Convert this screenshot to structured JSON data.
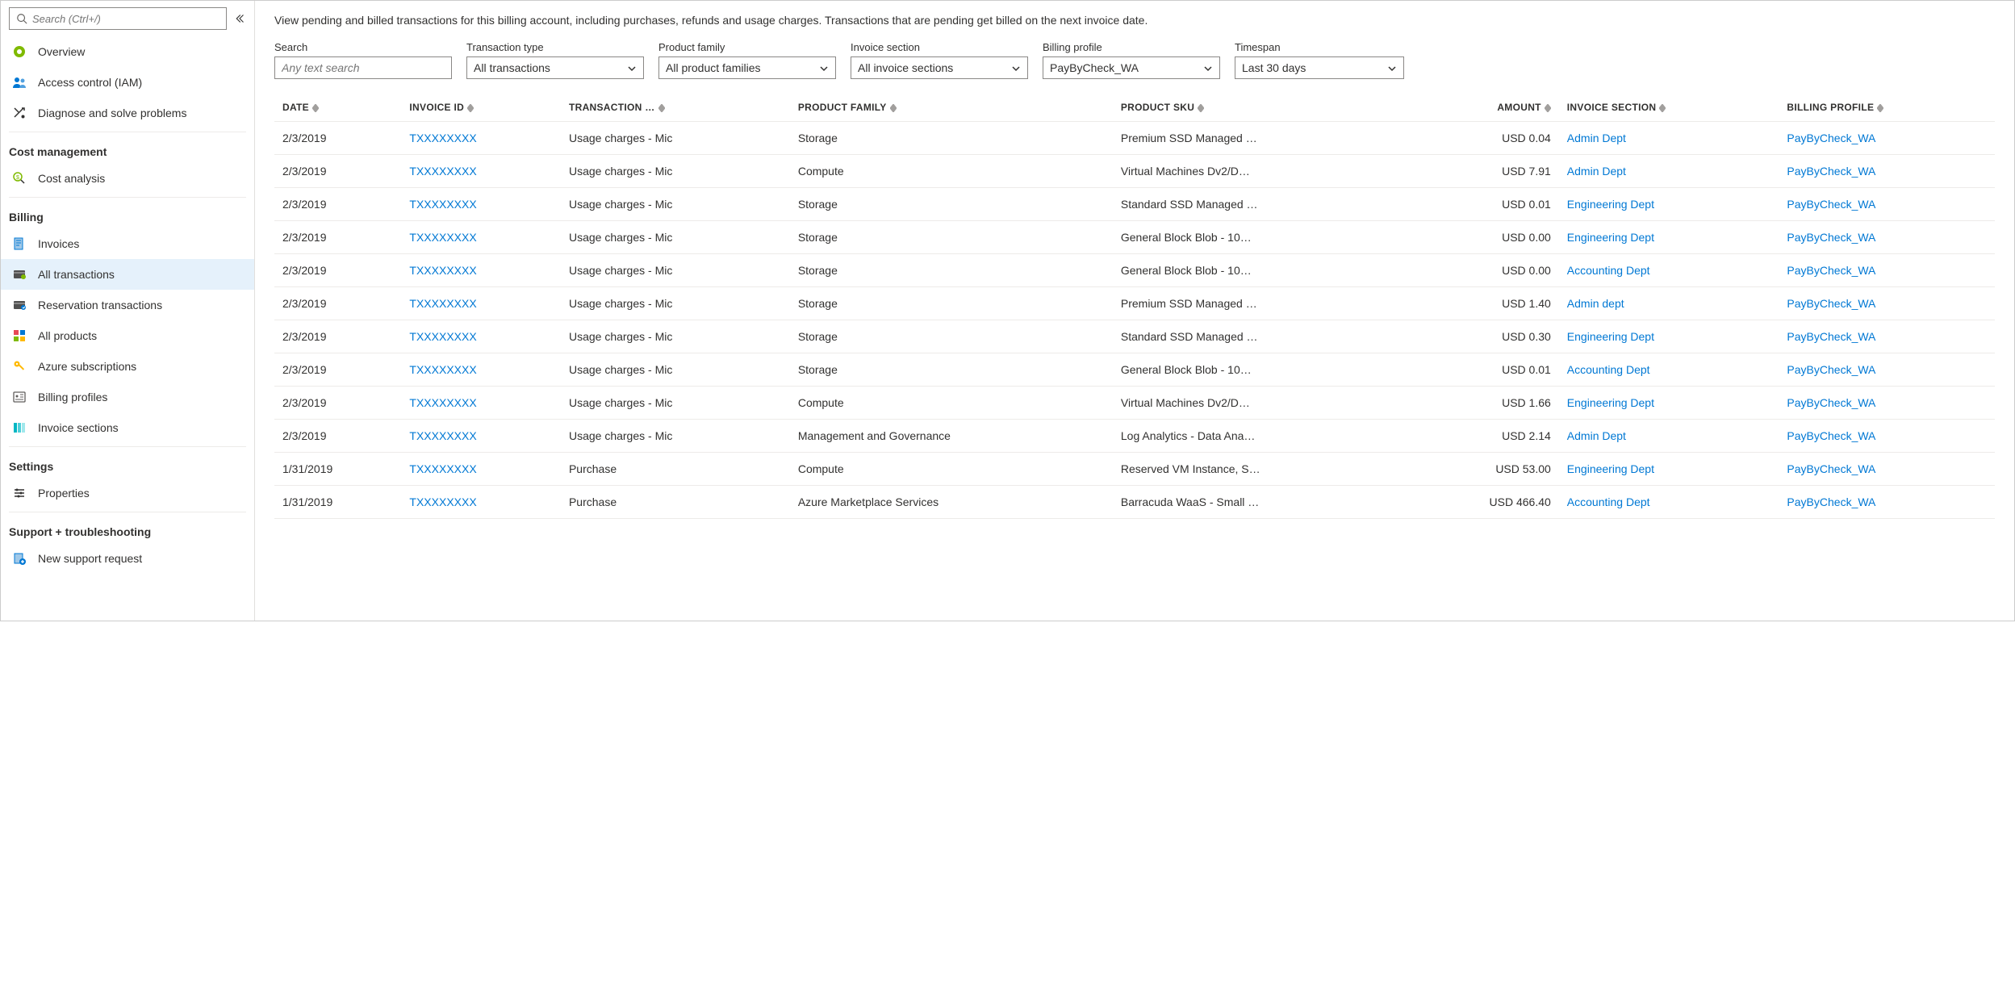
{
  "sidebar": {
    "search_placeholder": "Search (Ctrl+/)",
    "top": [
      {
        "label": "Overview",
        "icon": "overview"
      },
      {
        "label": "Access control (IAM)",
        "icon": "iam"
      },
      {
        "label": "Diagnose and solve problems",
        "icon": "diagnose"
      }
    ],
    "sections": [
      {
        "title": "Cost management",
        "items": [
          {
            "label": "Cost analysis",
            "icon": "cost-analysis"
          }
        ]
      },
      {
        "title": "Billing",
        "items": [
          {
            "label": "Invoices",
            "icon": "invoices"
          },
          {
            "label": "All transactions",
            "icon": "all-transactions",
            "active": true
          },
          {
            "label": "Reservation transactions",
            "icon": "reservation"
          },
          {
            "label": "All products",
            "icon": "products"
          },
          {
            "label": "Azure subscriptions",
            "icon": "key"
          },
          {
            "label": "Billing profiles",
            "icon": "billing-profiles"
          },
          {
            "label": "Invoice sections",
            "icon": "invoice-sections"
          }
        ]
      },
      {
        "title": "Settings",
        "items": [
          {
            "label": "Properties",
            "icon": "properties"
          }
        ]
      },
      {
        "title": "Support + troubleshooting",
        "items": [
          {
            "label": "New support request",
            "icon": "support"
          }
        ]
      }
    ]
  },
  "main": {
    "description": "View pending and billed transactions for this billing account, including purchases, refunds and usage charges. Transactions that are pending get billed on the next invoice date.",
    "filters": {
      "search": {
        "label": "Search",
        "placeholder": "Any text search"
      },
      "transaction_type": {
        "label": "Transaction type",
        "value": "All transactions"
      },
      "product_family": {
        "label": "Product family",
        "value": "All product families"
      },
      "invoice_section": {
        "label": "Invoice section",
        "value": "All invoice sections"
      },
      "billing_profile": {
        "label": "Billing profile",
        "value": "PayByCheck_WA"
      },
      "timespan": {
        "label": "Timespan",
        "value": "Last 30 days"
      }
    },
    "columns": [
      "DATE",
      "INVOICE ID",
      "TRANSACTION …",
      "PRODUCT FAMILY",
      "PRODUCT SKU",
      "AMOUNT",
      "INVOICE SECTION",
      "BILLING PROFILE"
    ],
    "rows": [
      {
        "date": "2/3/2019",
        "invoice_id": "TXXXXXXXX",
        "transaction": "Usage charges - Mic",
        "product_family": "Storage",
        "sku": "Premium SSD Managed …",
        "amount": "USD 0.04",
        "invoice_section": "Admin Dept",
        "billing_profile": "PayByCheck_WA"
      },
      {
        "date": "2/3/2019",
        "invoice_id": "TXXXXXXXX",
        "transaction": "Usage charges - Mic",
        "product_family": "Compute",
        "sku": "Virtual Machines Dv2/D…",
        "amount": "USD 7.91",
        "invoice_section": "Admin Dept",
        "billing_profile": "PayByCheck_WA"
      },
      {
        "date": "2/3/2019",
        "invoice_id": "TXXXXXXXX",
        "transaction": "Usage charges - Mic",
        "product_family": "Storage",
        "sku": "Standard SSD Managed …",
        "amount": "USD 0.01",
        "invoice_section": "Engineering Dept",
        "billing_profile": "PayByCheck_WA"
      },
      {
        "date": "2/3/2019",
        "invoice_id": "TXXXXXXXX",
        "transaction": "Usage charges - Mic",
        "product_family": "Storage",
        "sku": "General Block Blob - 10…",
        "amount": "USD 0.00",
        "invoice_section": "Engineering Dept",
        "billing_profile": "PayByCheck_WA"
      },
      {
        "date": "2/3/2019",
        "invoice_id": "TXXXXXXXX",
        "transaction": "Usage charges - Mic",
        "product_family": "Storage",
        "sku": "General Block Blob - 10…",
        "amount": "USD 0.00",
        "invoice_section": "Accounting Dept",
        "billing_profile": "PayByCheck_WA"
      },
      {
        "date": "2/3/2019",
        "invoice_id": "TXXXXXXXX",
        "transaction": "Usage charges - Mic",
        "product_family": "Storage",
        "sku": "Premium SSD Managed …",
        "amount": "USD 1.40",
        "invoice_section": "Admin dept",
        "billing_profile": "PayByCheck_WA"
      },
      {
        "date": "2/3/2019",
        "invoice_id": "TXXXXXXXX",
        "transaction": "Usage charges - Mic",
        "product_family": "Storage",
        "sku": "Standard SSD Managed …",
        "amount": "USD 0.30",
        "invoice_section": "Engineering Dept",
        "billing_profile": "PayByCheck_WA"
      },
      {
        "date": "2/3/2019",
        "invoice_id": "TXXXXXXXX",
        "transaction": "Usage charges - Mic",
        "product_family": "Storage",
        "sku": "General Block Blob - 10…",
        "amount": "USD 0.01",
        "invoice_section": "Accounting Dept",
        "billing_profile": "PayByCheck_WA"
      },
      {
        "date": "2/3/2019",
        "invoice_id": "TXXXXXXXX",
        "transaction": "Usage charges - Mic",
        "product_family": "Compute",
        "sku": "Virtual Machines Dv2/D…",
        "amount": "USD 1.66",
        "invoice_section": "Engineering Dept",
        "billing_profile": "PayByCheck_WA"
      },
      {
        "date": "2/3/2019",
        "invoice_id": "TXXXXXXXX",
        "transaction": "Usage charges - Mic",
        "product_family": "Management and Governance",
        "sku": "Log Analytics - Data Ana…",
        "amount": "USD 2.14",
        "invoice_section": "Admin Dept",
        "billing_profile": "PayByCheck_WA"
      },
      {
        "date": "1/31/2019",
        "invoice_id": "TXXXXXXXX",
        "transaction": "Purchase",
        "product_family": "Compute",
        "sku": "Reserved VM Instance, S…",
        "amount": "USD 53.00",
        "invoice_section": "Engineering Dept",
        "billing_profile": "PayByCheck_WA"
      },
      {
        "date": "1/31/2019",
        "invoice_id": "TXXXXXXXX",
        "transaction": "Purchase",
        "product_family": "Azure Marketplace Services",
        "sku": "Barracuda WaaS - Small …",
        "amount": "USD 466.40",
        "invoice_section": "Accounting Dept",
        "billing_profile": "PayByCheck_WA"
      }
    ]
  }
}
